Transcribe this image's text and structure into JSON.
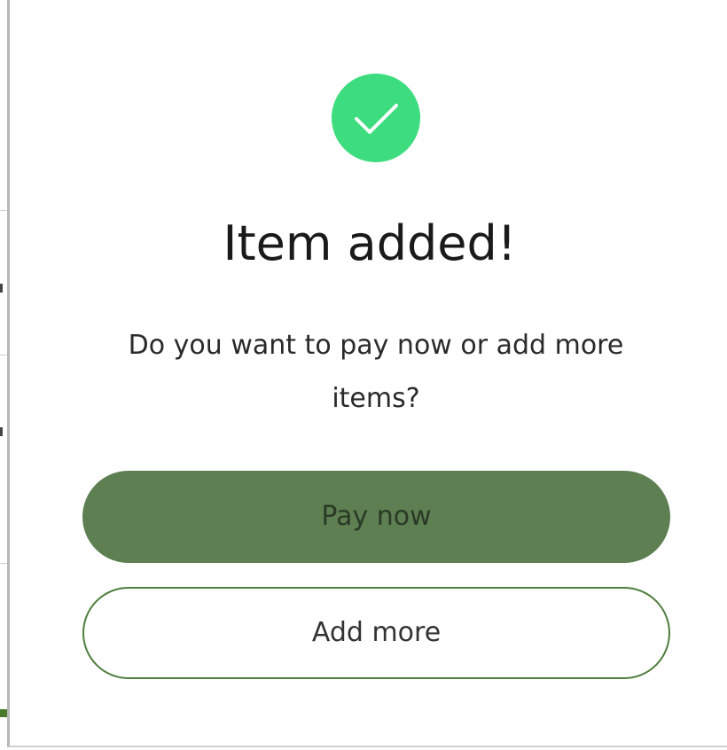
{
  "dialog": {
    "icon": "checkmark-icon",
    "title": "Item added!",
    "message": "Do you want to pay now or add more items?",
    "primary_button_label": "Pay now",
    "secondary_button_label": "Add more"
  },
  "colors": {
    "success": "#3ddc7e",
    "primary_button": "#5d7f51",
    "secondary_button_border": "#4f7d3f"
  }
}
